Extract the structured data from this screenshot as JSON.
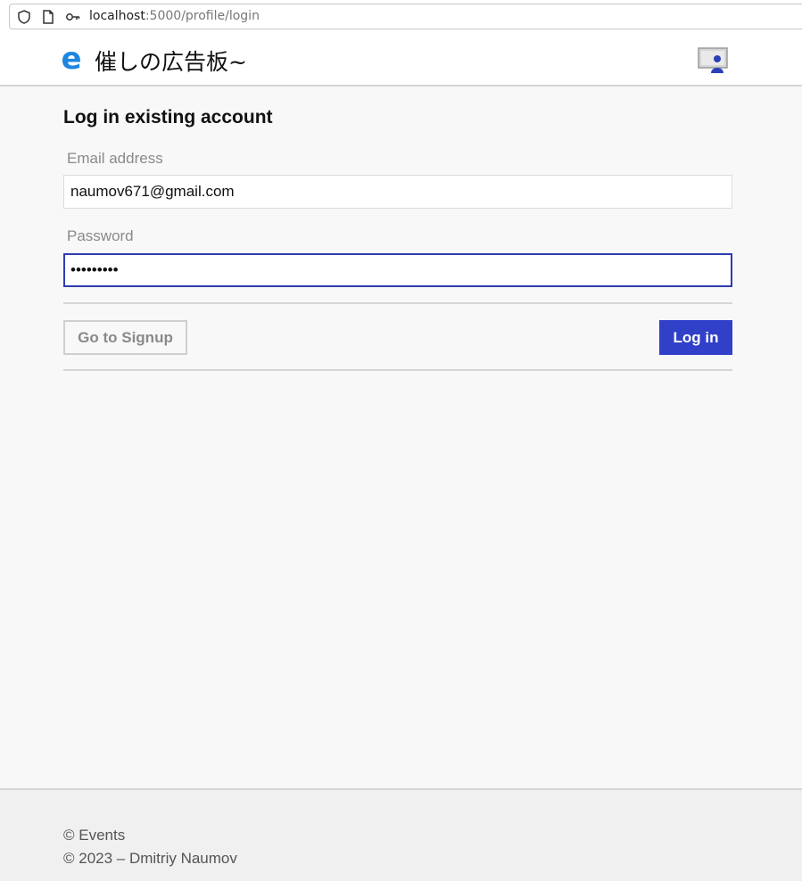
{
  "browser": {
    "url_host": "localhost",
    "url_rest": ":5000/profile/login"
  },
  "header": {
    "logo_glyph": "e",
    "title": "催しの広告板~",
    "logo_color": "#1f86e0"
  },
  "main": {
    "title": "Log in existing account",
    "email_label": "Email address",
    "email_value": "naumov671@gmail.com",
    "password_label": "Password",
    "password_value": "•••••••••",
    "signup_button": "Go to Signup",
    "login_button": "Log in",
    "primary_color": "#3040c8"
  },
  "footer": {
    "line1": "© Events",
    "line2": "© 2023 – Dmitriy Naumov"
  }
}
